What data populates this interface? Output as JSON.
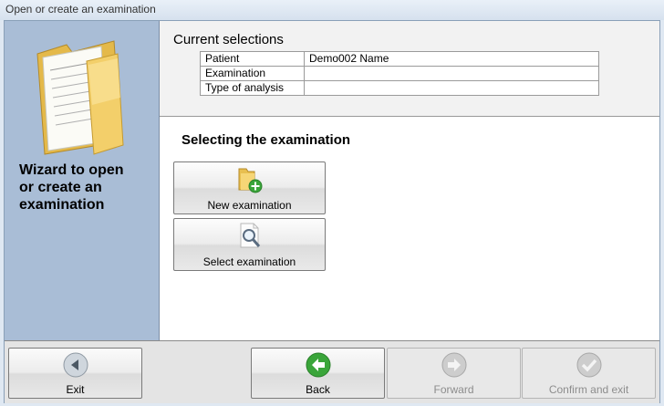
{
  "window": {
    "title": "Open or create an examination"
  },
  "sidebar": {
    "title": "Wizard to open\nor create an\nexamination"
  },
  "selections": {
    "heading": "Current selections",
    "rows": [
      {
        "label": "Patient",
        "value": "Demo002 Name"
      },
      {
        "label": "Examination",
        "value": ""
      },
      {
        "label": "Type of analysis",
        "value": ""
      }
    ]
  },
  "main": {
    "title": "Selecting the  examination",
    "new_examination_label": "New examination",
    "select_examination_label": "Select examination"
  },
  "footer": {
    "exit_label": "Exit",
    "back_label": "Back",
    "forward_label": "Forward",
    "confirm_label": "Confirm and exit",
    "forward_enabled": false,
    "confirm_enabled": false
  },
  "colors": {
    "sidebar_bg": "#a9bdd6",
    "back_green": "#3aa53a",
    "folder_yellow": "#f3cf6a"
  }
}
